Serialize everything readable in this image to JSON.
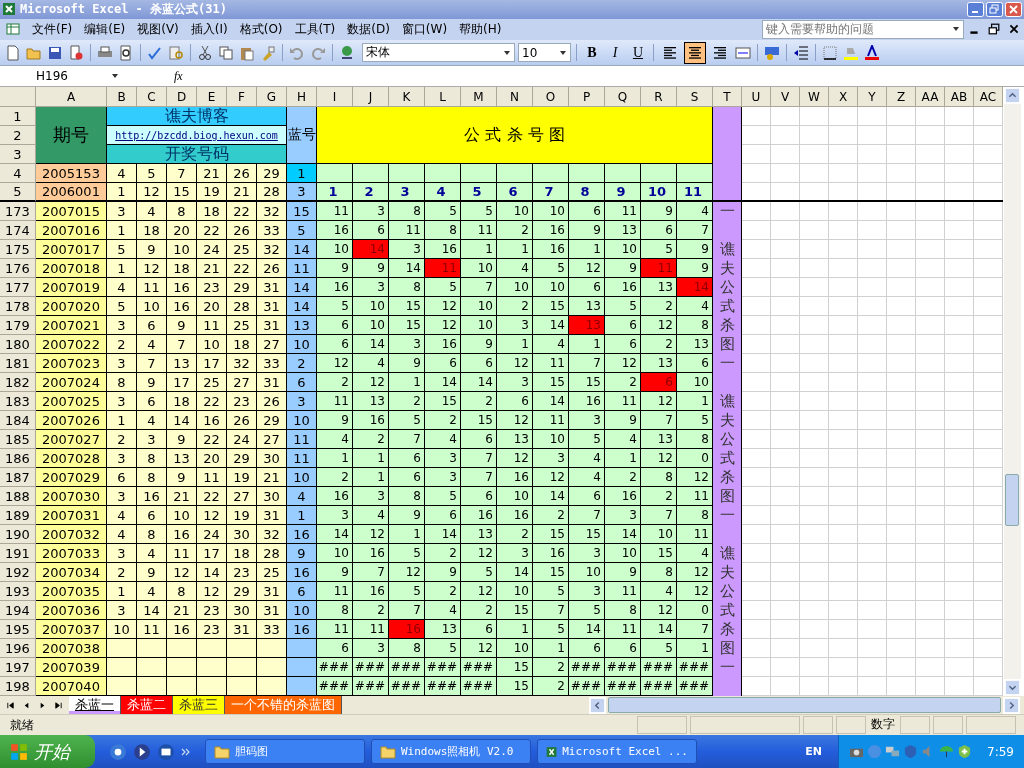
{
  "window": {
    "title": "Microsoft Excel - 杀蓝公式(31)"
  },
  "menu": [
    "文件(F)",
    "编辑(E)",
    "视图(V)",
    "插入(I)",
    "格式(O)",
    "工具(T)",
    "数据(D)",
    "窗口(W)",
    "帮助(H)"
  ],
  "help_search": {
    "placeholder": "键入需要帮助的问题"
  },
  "toolbar": {
    "font": "宋体",
    "size": "10",
    "bold": "B",
    "italic": "I",
    "underline": "U",
    "alignment": [
      {
        "kind": "left",
        "selected": false
      },
      {
        "kind": "center",
        "selected": true
      },
      {
        "kind": "right",
        "selected": false
      }
    ]
  },
  "formula_bar": {
    "cell_ref": "H196",
    "fx": "fx"
  },
  "columns": [
    "A",
    "B",
    "C",
    "D",
    "E",
    "F",
    "G",
    "H",
    "I",
    "J",
    "K",
    "L",
    "M",
    "N",
    "O",
    "P",
    "Q",
    "R",
    "S",
    "T",
    "U",
    "V",
    "W",
    "X",
    "Y",
    "Z",
    "AA",
    "AB",
    "AC"
  ],
  "header": {
    "row_numbers": [
      "1",
      "2",
      "3",
      "4",
      "5"
    ],
    "period_label": "期号",
    "blog_title": "谯夫博客",
    "blog_url": "http://bzcdd.biog.hexun.com",
    "draw_label": "开奖号码",
    "blue_label": "蓝号",
    "chart_title": "公 式 杀 号 图"
  },
  "seed_rows": [
    {
      "period": "2005153",
      "numbers": [
        "4",
        "5",
        "7",
        "21",
        "26",
        "29"
      ],
      "blue": "1"
    },
    {
      "period": "2006001",
      "numbers": [
        "1",
        "12",
        "15",
        "19",
        "21",
        "28"
      ],
      "blue": "3",
      "formulas": [
        "1",
        "2",
        "3",
        "4",
        "5",
        "6",
        "7",
        "8",
        "9",
        "10",
        "11"
      ]
    }
  ],
  "rows": [
    {
      "row": "173",
      "period": "2007015",
      "numbers": [
        "3",
        "4",
        "8",
        "18",
        "22",
        "32"
      ],
      "blue": "15",
      "kills": [
        "11",
        "3",
        "8",
        "5",
        "5",
        "10",
        "10",
        "6",
        "11",
        "9",
        "4"
      ],
      "hits": [
        false,
        false,
        false,
        false,
        false,
        false,
        false,
        false,
        false,
        false,
        false
      ],
      "side": "一"
    },
    {
      "row": "174",
      "period": "2007016",
      "numbers": [
        "1",
        "18",
        "20",
        "22",
        "26",
        "33"
      ],
      "blue": "5",
      "kills": [
        "16",
        "6",
        "11",
        "8",
        "11",
        "2",
        "16",
        "9",
        "13",
        "6",
        "7"
      ],
      "hits": [
        false,
        false,
        false,
        false,
        false,
        false,
        false,
        false,
        false,
        false,
        false
      ]
    },
    {
      "row": "175",
      "period": "2007017",
      "numbers": [
        "5",
        "9",
        "10",
        "24",
        "25",
        "32"
      ],
      "blue": "14",
      "kills": [
        "10",
        "14",
        "3",
        "16",
        "1",
        "1",
        "16",
        "1",
        "10",
        "5",
        "9"
      ],
      "hits": [
        false,
        true,
        false,
        false,
        false,
        false,
        false,
        false,
        false,
        false,
        false
      ],
      "side": "谯"
    },
    {
      "row": "176",
      "period": "2007018",
      "numbers": [
        "1",
        "12",
        "18",
        "21",
        "22",
        "26"
      ],
      "blue": "11",
      "kills": [
        "9",
        "9",
        "14",
        "11",
        "10",
        "4",
        "5",
        "12",
        "9",
        "11",
        "9"
      ],
      "hits": [
        false,
        false,
        false,
        true,
        false,
        false,
        false,
        false,
        false,
        true,
        false
      ],
      "side": "夫"
    },
    {
      "row": "177",
      "period": "2007019",
      "numbers": [
        "4",
        "11",
        "16",
        "23",
        "29",
        "31"
      ],
      "blue": "14",
      "kills": [
        "16",
        "3",
        "8",
        "5",
        "7",
        "10",
        "10",
        "6",
        "16",
        "13",
        "14"
      ],
      "hits": [
        false,
        false,
        false,
        false,
        false,
        false,
        false,
        false,
        false,
        false,
        true
      ],
      "side": "公"
    },
    {
      "row": "178",
      "period": "2007020",
      "numbers": [
        "5",
        "10",
        "16",
        "20",
        "28",
        "31"
      ],
      "blue": "14",
      "kills": [
        "5",
        "10",
        "15",
        "12",
        "10",
        "2",
        "15",
        "13",
        "5",
        "2",
        "4"
      ],
      "hits": [
        false,
        false,
        false,
        false,
        false,
        false,
        false,
        false,
        false,
        false,
        false
      ],
      "side": "式"
    },
    {
      "row": "179",
      "period": "2007021",
      "numbers": [
        "3",
        "6",
        "9",
        "11",
        "25",
        "31"
      ],
      "blue": "13",
      "kills": [
        "6",
        "10",
        "15",
        "12",
        "10",
        "3",
        "14",
        "13",
        "6",
        "12",
        "8"
      ],
      "hits": [
        false,
        false,
        false,
        false,
        false,
        false,
        false,
        true,
        false,
        false,
        false
      ],
      "side": "杀"
    },
    {
      "row": "180",
      "period": "2007022",
      "numbers": [
        "2",
        "4",
        "7",
        "10",
        "18",
        "27"
      ],
      "blue": "10",
      "kills": [
        "6",
        "14",
        "3",
        "16",
        "9",
        "1",
        "4",
        "1",
        "6",
        "2",
        "13"
      ],
      "hits": [
        false,
        false,
        false,
        false,
        false,
        false,
        false,
        false,
        false,
        false,
        false
      ],
      "side": "图"
    },
    {
      "row": "181",
      "period": "2007023",
      "numbers": [
        "3",
        "7",
        "13",
        "17",
        "32",
        "33"
      ],
      "blue": "2",
      "kills": [
        "12",
        "4",
        "9",
        "6",
        "6",
        "12",
        "11",
        "7",
        "12",
        "13",
        "6"
      ],
      "hits": [
        false,
        false,
        false,
        false,
        false,
        false,
        false,
        false,
        false,
        false,
        false
      ],
      "side": "一"
    },
    {
      "row": "182",
      "period": "2007024",
      "numbers": [
        "8",
        "9",
        "17",
        "25",
        "27",
        "31"
      ],
      "blue": "6",
      "kills": [
        "2",
        "12",
        "1",
        "14",
        "14",
        "3",
        "15",
        "15",
        "2",
        "6",
        "10"
      ],
      "hits": [
        false,
        false,
        false,
        false,
        false,
        false,
        false,
        false,
        false,
        true,
        false
      ]
    },
    {
      "row": "183",
      "period": "2007025",
      "numbers": [
        "3",
        "6",
        "18",
        "22",
        "23",
        "26"
      ],
      "blue": "3",
      "kills": [
        "11",
        "13",
        "2",
        "15",
        "2",
        "6",
        "14",
        "16",
        "11",
        "12",
        "1"
      ],
      "hits": [
        false,
        false,
        false,
        false,
        false,
        false,
        false,
        false,
        false,
        false,
        false
      ],
      "side": "谯"
    },
    {
      "row": "184",
      "period": "2007026",
      "numbers": [
        "1",
        "4",
        "14",
        "16",
        "26",
        "29"
      ],
      "blue": "10",
      "kills": [
        "9",
        "16",
        "5",
        "2",
        "15",
        "12",
        "11",
        "3",
        "9",
        "7",
        "5"
      ],
      "hits": [
        false,
        false,
        false,
        false,
        false,
        false,
        false,
        false,
        false,
        false,
        false
      ],
      "side": "夫"
    },
    {
      "row": "185",
      "period": "2007027",
      "numbers": [
        "2",
        "3",
        "9",
        "22",
        "24",
        "27"
      ],
      "blue": "11",
      "kills": [
        "4",
        "2",
        "7",
        "4",
        "6",
        "13",
        "10",
        "5",
        "4",
        "13",
        "8"
      ],
      "hits": [
        false,
        false,
        false,
        false,
        false,
        false,
        false,
        false,
        false,
        false,
        false
      ],
      "side": "公"
    },
    {
      "row": "186",
      "period": "2007028",
      "numbers": [
        "3",
        "8",
        "13",
        "20",
        "29",
        "30"
      ],
      "blue": "11",
      "kills": [
        "1",
        "1",
        "6",
        "3",
        "7",
        "12",
        "3",
        "4",
        "1",
        "12",
        "0"
      ],
      "hits": [
        false,
        false,
        false,
        false,
        false,
        false,
        false,
        false,
        false,
        false,
        false
      ],
      "side": "式"
    },
    {
      "row": "187",
      "period": "2007029",
      "numbers": [
        "6",
        "8",
        "9",
        "11",
        "19",
        "21"
      ],
      "blue": "10",
      "kills": [
        "2",
        "1",
        "6",
        "3",
        "7",
        "16",
        "12",
        "4",
        "2",
        "8",
        "12"
      ],
      "hits": [
        false,
        false,
        false,
        false,
        false,
        false,
        false,
        false,
        false,
        false,
        false
      ],
      "side": "杀"
    },
    {
      "row": "188",
      "period": "2007030",
      "numbers": [
        "3",
        "16",
        "21",
        "22",
        "27",
        "30"
      ],
      "blue": "4",
      "kills": [
        "16",
        "3",
        "8",
        "5",
        "6",
        "10",
        "14",
        "6",
        "16",
        "2",
        "11"
      ],
      "hits": [
        false,
        false,
        false,
        false,
        false,
        false,
        false,
        false,
        false,
        false,
        false
      ],
      "side": "图"
    },
    {
      "row": "189",
      "period": "2007031",
      "numbers": [
        "4",
        "6",
        "10",
        "12",
        "19",
        "31"
      ],
      "blue": "1",
      "kills": [
        "3",
        "4",
        "9",
        "6",
        "16",
        "16",
        "2",
        "7",
        "3",
        "7",
        "8"
      ],
      "hits": [
        false,
        false,
        false,
        false,
        false,
        false,
        false,
        false,
        false,
        false,
        false
      ],
      "side": "一"
    },
    {
      "row": "190",
      "period": "2007032",
      "numbers": [
        "4",
        "8",
        "16",
        "24",
        "30",
        "32"
      ],
      "blue": "16",
      "kills": [
        "14",
        "12",
        "1",
        "14",
        "13",
        "2",
        "15",
        "15",
        "14",
        "10",
        "11"
      ],
      "hits": [
        false,
        false,
        false,
        false,
        false,
        false,
        false,
        false,
        false,
        false,
        false
      ]
    },
    {
      "row": "191",
      "period": "2007033",
      "numbers": [
        "3",
        "4",
        "11",
        "17",
        "18",
        "28"
      ],
      "blue": "9",
      "kills": [
        "10",
        "16",
        "5",
        "2",
        "12",
        "3",
        "16",
        "3",
        "10",
        "15",
        "4"
      ],
      "hits": [
        false,
        false,
        false,
        false,
        false,
        false,
        false,
        false,
        false,
        false,
        false
      ],
      "side": "谯"
    },
    {
      "row": "192",
      "period": "2007034",
      "numbers": [
        "2",
        "9",
        "12",
        "14",
        "23",
        "25"
      ],
      "blue": "16",
      "kills": [
        "9",
        "7",
        "12",
        "9",
        "5",
        "14",
        "15",
        "10",
        "9",
        "8",
        "12"
      ],
      "hits": [
        false,
        false,
        false,
        false,
        false,
        false,
        false,
        false,
        false,
        false,
        false
      ],
      "side": "夫"
    },
    {
      "row": "193",
      "period": "2007035",
      "numbers": [
        "1",
        "4",
        "8",
        "12",
        "29",
        "31"
      ],
      "blue": "6",
      "kills": [
        "11",
        "16",
        "5",
        "2",
        "12",
        "10",
        "5",
        "3",
        "11",
        "4",
        "12"
      ],
      "hits": [
        false,
        false,
        false,
        false,
        false,
        false,
        false,
        false,
        false,
        false,
        false
      ],
      "side": "公"
    },
    {
      "row": "194",
      "period": "2007036",
      "numbers": [
        "3",
        "14",
        "21",
        "23",
        "30",
        "31"
      ],
      "blue": "10",
      "kills": [
        "8",
        "2",
        "7",
        "4",
        "2",
        "15",
        "7",
        "5",
        "8",
        "12",
        "0"
      ],
      "hits": [
        false,
        false,
        false,
        false,
        false,
        false,
        false,
        false,
        false,
        false,
        false
      ],
      "side": "式"
    },
    {
      "row": "195",
      "period": "2007037",
      "numbers": [
        "10",
        "11",
        "16",
        "23",
        "31",
        "33"
      ],
      "blue": "16",
      "kills": [
        "11",
        "11",
        "16",
        "13",
        "6",
        "1",
        "5",
        "14",
        "11",
        "14",
        "7"
      ],
      "hits": [
        false,
        false,
        true,
        false,
        false,
        false,
        false,
        false,
        false,
        false,
        false
      ],
      "side": "杀"
    },
    {
      "row": "196",
      "period": "2007038",
      "kills": [
        "6",
        "3",
        "8",
        "5",
        "12",
        "10",
        "1",
        "6",
        "6",
        "5",
        "1"
      ],
      "hits": [
        false,
        false,
        false,
        false,
        false,
        false,
        false,
        false,
        false,
        false,
        false
      ],
      "side": "图"
    },
    {
      "row": "197",
      "period": "2007039",
      "kills": [
        "###",
        "###",
        "###",
        "###",
        "###",
        "15",
        "2",
        "###",
        "###",
        "###",
        "###"
      ],
      "hits": [
        false,
        false,
        false,
        false,
        false,
        false,
        false,
        false,
        false,
        false,
        false
      ],
      "side": "一"
    },
    {
      "row": "198",
      "period": "2007040",
      "kills": [
        "###",
        "###",
        "###",
        "###",
        "###",
        "15",
        "2",
        "###",
        "###",
        "###",
        "###"
      ],
      "hits": [
        false,
        false,
        false,
        false,
        false,
        false,
        false,
        false,
        false,
        false,
        false
      ]
    }
  ],
  "sheet_tabs": [
    {
      "label": "杀蓝一",
      "selected": true,
      "color": "#cc99ff"
    },
    {
      "label": "杀蓝二",
      "selected": false,
      "color": "#ff0000"
    },
    {
      "label": "杀蓝三",
      "selected": false,
      "color": "#ffff00"
    },
    {
      "label": "一个不错的杀蓝图",
      "selected": false,
      "color": "#ff6600"
    }
  ],
  "status": {
    "ready": "就绪",
    "mode": "数字"
  },
  "taskbar": {
    "start": "开始",
    "tasks": [
      {
        "label": "胆码图",
        "kind": "folder",
        "selected": false
      },
      {
        "label": "Windows照相机 V2.0",
        "kind": "folder",
        "selected": false
      },
      {
        "label": "Microsoft Excel ...",
        "kind": "excel",
        "selected": false
      }
    ],
    "lang": "EN",
    "clock": "7:59"
  }
}
